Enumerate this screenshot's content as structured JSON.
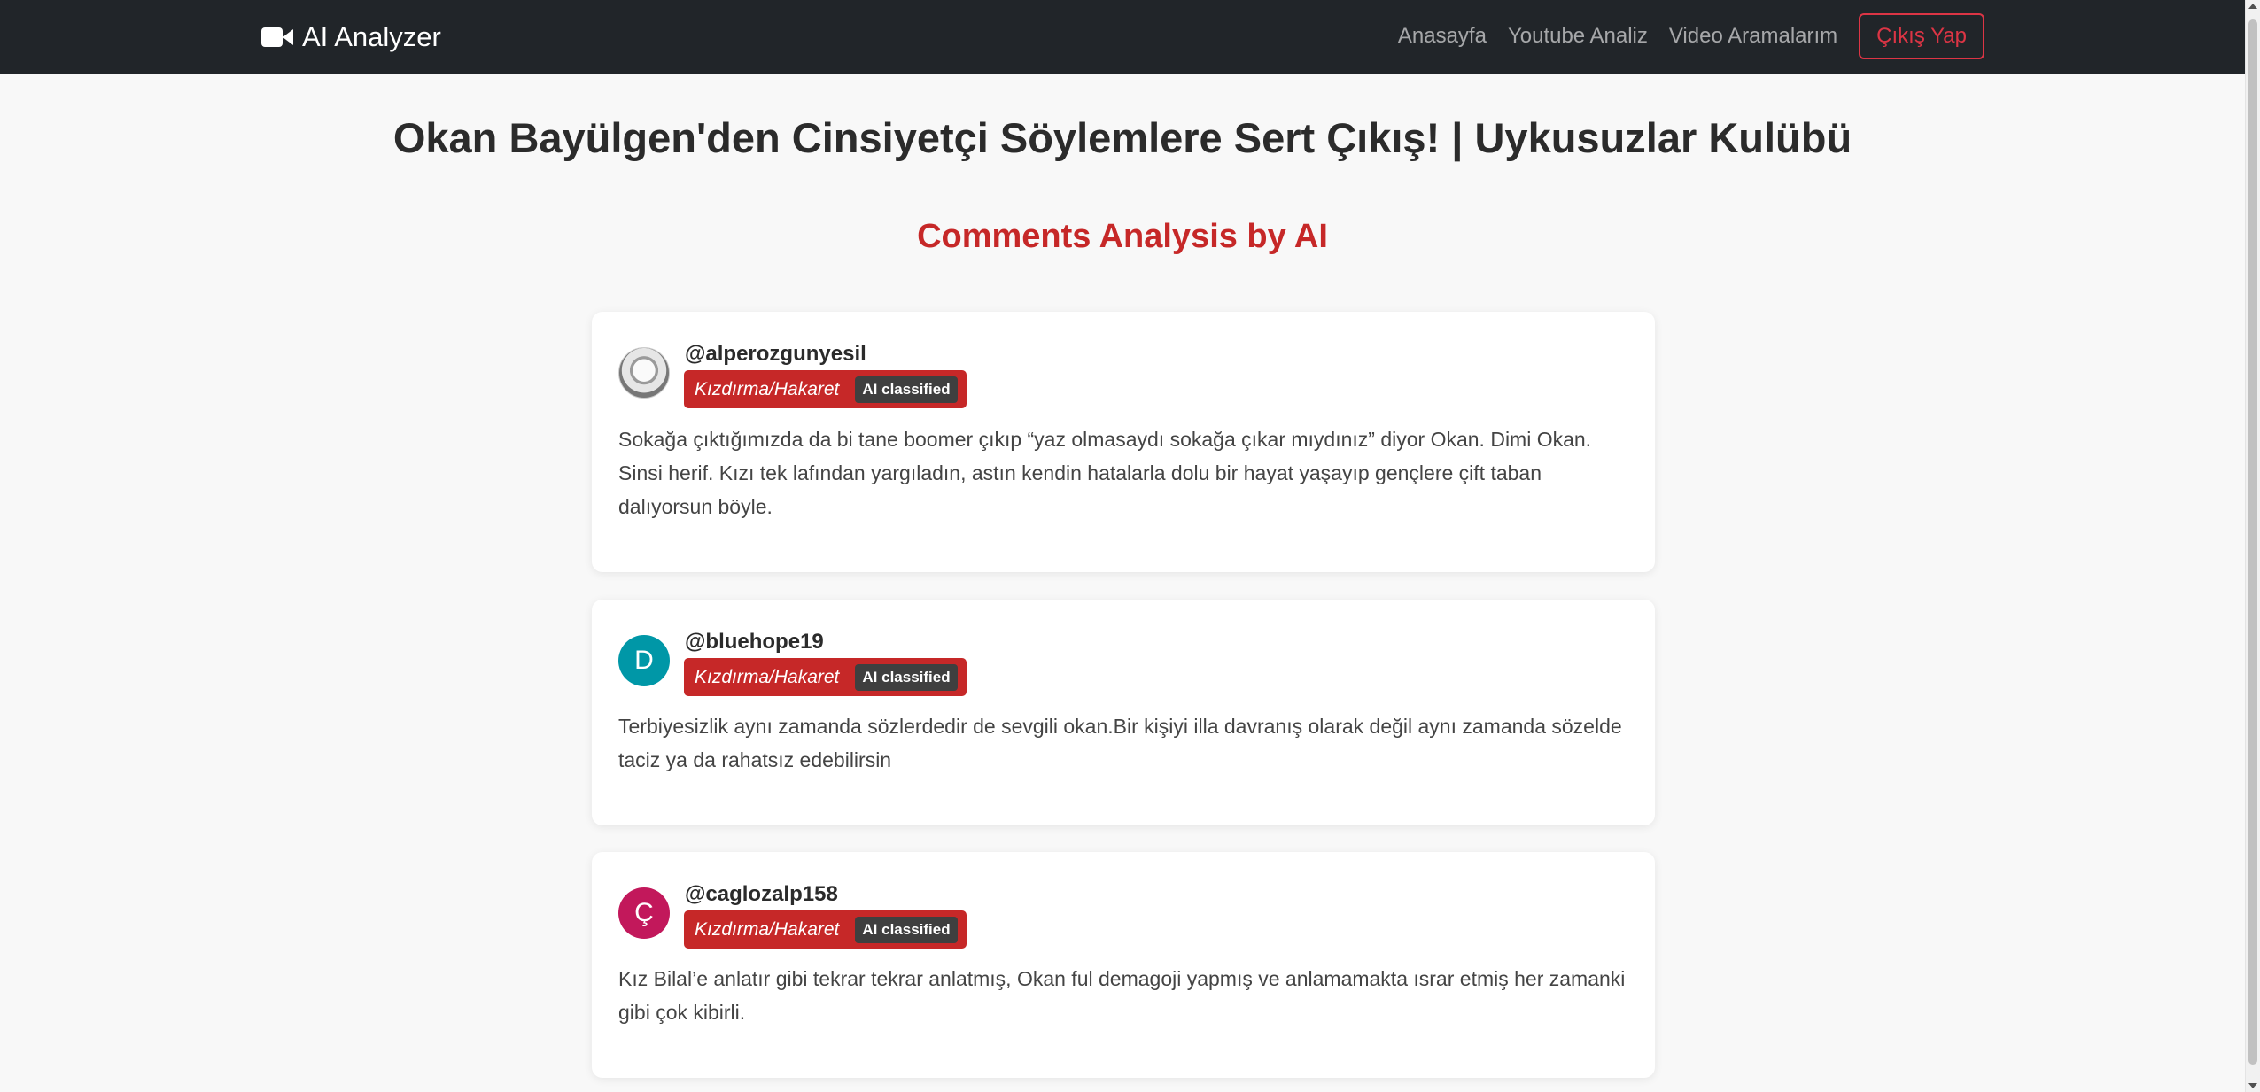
{
  "nav": {
    "brand": "AI Analyzer",
    "links": [
      "Anasayfa",
      "Youtube Analiz",
      "Video Aramalarım"
    ],
    "logout": "Çıkış Yap"
  },
  "video_title": "Okan Bayülgen'den Cinsiyetçi Söylemlere Sert Çıkış! | Uykusuzlar Kulübü",
  "section_title": "Comments Analysis by AI",
  "colors": {
    "accent": "#c62828",
    "navbar": "#212529",
    "logout": "#dc3545"
  },
  "comments": [
    {
      "username": "@alperozgunyesil",
      "avatar_letter": "",
      "avatar_type": "photo",
      "label": "Kızdırma/Hakaret",
      "badge": "AI classified",
      "text": "Sokağa çıktığımızda da bi tane boomer çıkıp “yaz olmasaydı sokağa çıkar mıydınız” diyor Okan. Dimi Okan. Sinsi herif. Kızı tek lafından yargıladın, astın kendin hatalarla dolu bir hayat yaşayıp gençlere çift taban dalıyorsun böyle."
    },
    {
      "username": "@bluehope19",
      "avatar_letter": "D",
      "avatar_color": "#0097a7",
      "label": "Kızdırma/Hakaret",
      "badge": "AI classified",
      "text": "Terbiyesizlik aynı zamanda sözlerdedir de sevgili okan.Bir kişiyi illa davranış olarak değil aynı zamanda sözelde taciz ya da rahatsız edebilirsin"
    },
    {
      "username": "@caglozalp158",
      "avatar_letter": "Ç",
      "avatar_color": "#c2185b",
      "label": "Kızdırma/Hakaret",
      "badge": "AI classified",
      "text": "Kız Bilal’e anlatır gibi tekrar tekrar anlatmış, Okan ful demagoji yapmış ve anlamamakta ısrar etmiş her zamanki gibi çok kibirli."
    }
  ]
}
